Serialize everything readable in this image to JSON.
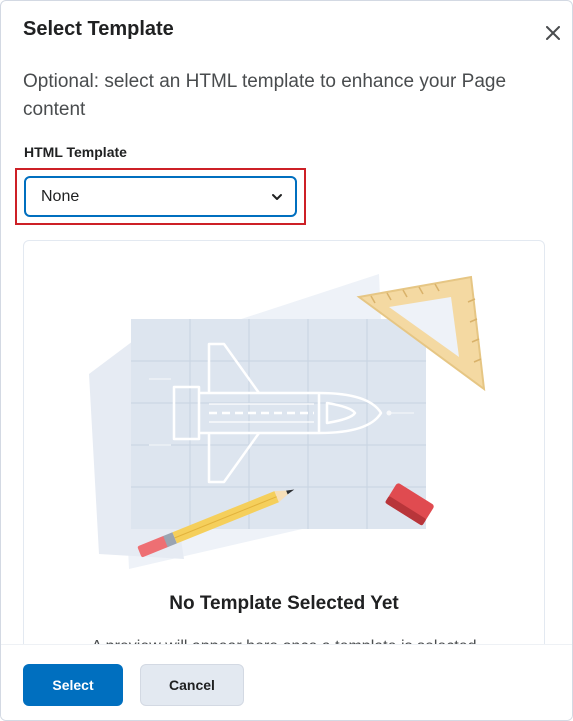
{
  "dialog": {
    "title": "Select Template",
    "close_icon": "close-icon",
    "description": "Optional: select an HTML template to enhance your Page content"
  },
  "field": {
    "label": "HTML Template",
    "selected_value": "None",
    "chevron_icon": "chevron-down-icon"
  },
  "preview": {
    "illustration": "blueprint-illustration",
    "empty_title": "No Template Selected Yet",
    "empty_description": "A preview will appear here once a template is selected"
  },
  "footer": {
    "primary_label": "Select",
    "secondary_label": "Cancel"
  },
  "colors": {
    "accent": "#006fbf",
    "focus_outline": "#cd2026",
    "secondary_button": "#e3e9f1"
  }
}
